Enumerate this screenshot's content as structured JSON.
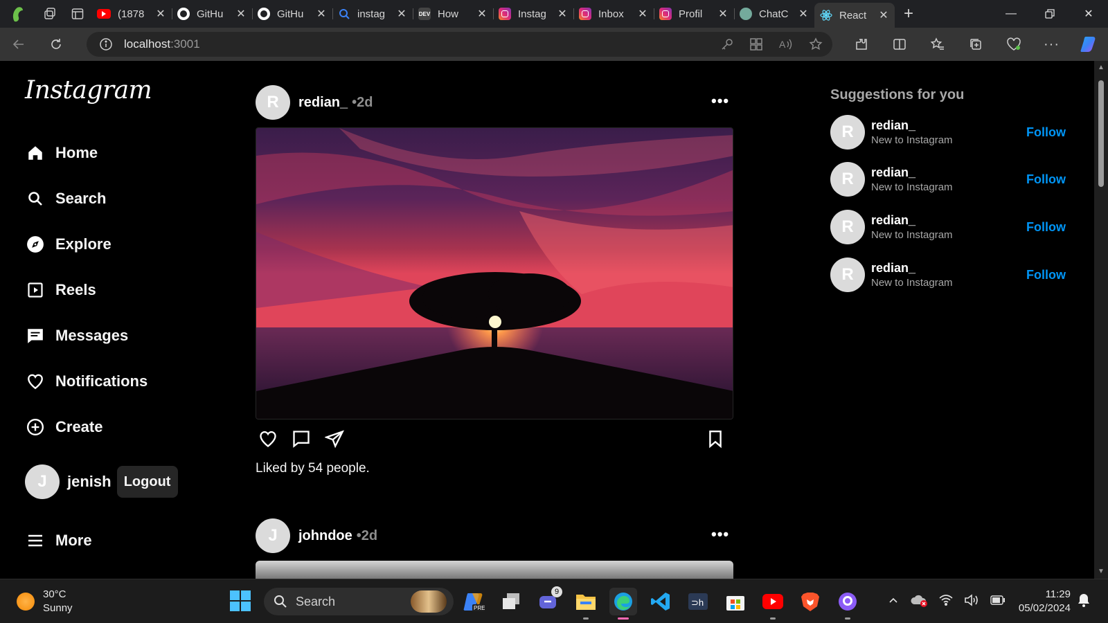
{
  "browser": {
    "tabs": [
      {
        "title": "(1878",
        "icon": "youtube-icon",
        "color": "#ff0000"
      },
      {
        "title": "GitHu",
        "icon": "github-icon",
        "color": "#ffffff"
      },
      {
        "title": "GitHu",
        "icon": "github-icon",
        "color": "#ffffff"
      },
      {
        "title": "instag",
        "icon": "search-icon",
        "color": "#3b82f6"
      },
      {
        "title": "How",
        "icon": "dev-icon",
        "color": "#444444",
        "badge": "DEV"
      },
      {
        "title": "Instag",
        "icon": "instagram-icon",
        "color": "#c13584"
      },
      {
        "title": "Inbox",
        "icon": "instagram-icon",
        "color": "#c13584"
      },
      {
        "title": "Profil",
        "icon": "instagram-icon",
        "color": "#e1306c"
      },
      {
        "title": "ChatC",
        "icon": "chatgpt-icon",
        "color": "#74aa9c"
      },
      {
        "title": "React",
        "icon": "react-icon",
        "color": "#61dafb",
        "active": true
      }
    ],
    "url_host": "localhost",
    "url_port": ":3001"
  },
  "sidebar": {
    "logo": "Instagram",
    "items": [
      {
        "label": "Home",
        "icon": "home-icon"
      },
      {
        "label": "Search",
        "icon": "search-icon"
      },
      {
        "label": "Explore",
        "icon": "compass-icon"
      },
      {
        "label": "Reels",
        "icon": "reels-icon"
      },
      {
        "label": "Messages",
        "icon": "messages-icon"
      },
      {
        "label": "Notifications",
        "icon": "heart-icon"
      },
      {
        "label": "Create",
        "icon": "plus-circle-icon"
      }
    ],
    "user": {
      "initial": "J",
      "name": "jenish",
      "logout_label": "Logout"
    },
    "more_label": "More"
  },
  "feed": {
    "posts": [
      {
        "initial": "R",
        "username": "redian_",
        "time": "•2d",
        "likes_text": "Liked by 54 people."
      },
      {
        "initial": "J",
        "username": "johndoe",
        "time": "•2d"
      }
    ],
    "more_glyph": "•••"
  },
  "suggestions": {
    "title": "Suggestions for you",
    "items": [
      {
        "initial": "R",
        "name": "redian_",
        "subtitle": "New to Instagram",
        "action": "Follow"
      },
      {
        "initial": "R",
        "name": "redian_",
        "subtitle": "New to Instagram",
        "action": "Follow"
      },
      {
        "initial": "R",
        "name": "redian_",
        "subtitle": "New to Instagram",
        "action": "Follow"
      },
      {
        "initial": "R",
        "name": "redian_",
        "subtitle": "New to Instagram",
        "action": "Follow"
      }
    ]
  },
  "taskbar": {
    "weather_temp": "30°C",
    "weather_desc": "Sunny",
    "search_label": "Search",
    "teams_badge": "9",
    "time": "11:29",
    "date": "05/02/2024"
  },
  "colors": {
    "accent": "#0095f6",
    "background": "#000000",
    "muted": "#a8a8a8"
  }
}
